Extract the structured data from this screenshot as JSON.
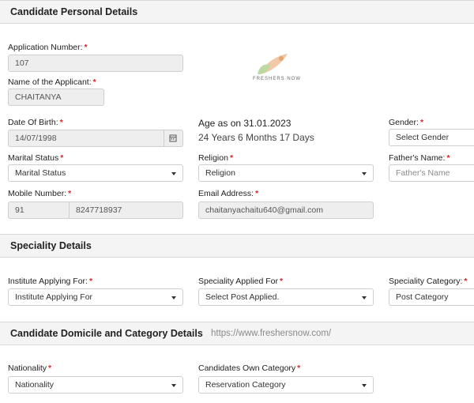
{
  "personal": {
    "title": "Candidate Personal Details",
    "application_number": {
      "label": "Application Number:",
      "value": "107"
    },
    "applicant_name": {
      "label": "Name of the Applicant:",
      "value": "CHAITANYA"
    },
    "dob": {
      "label": "Date Of Birth:",
      "value": "14/07/1998"
    },
    "age": {
      "title": "Age as on 31.01.2023",
      "value": "24 Years 6 Months 17 Days"
    },
    "gender": {
      "label": "Gender:",
      "selected": "Select Gender"
    },
    "marital": {
      "label": "Marital Status",
      "selected": "Marital Status"
    },
    "religion": {
      "label": "Religion",
      "selected": "Religion"
    },
    "father": {
      "label": "Father's Name:",
      "placeholder": "Father's Name"
    },
    "mobile": {
      "label": "Mobile Number:",
      "code": "91",
      "number": "8247718937"
    },
    "email": {
      "label": "Email Address:",
      "value": "chaitanyachaitu640@gmail.com"
    },
    "logo_text": "FRESHERS NOW",
    "required_mark": "*"
  },
  "speciality": {
    "title": "Speciality Details",
    "institute": {
      "label": "Institute Applying For:",
      "selected": "Institute Applying For"
    },
    "applied_for": {
      "label": "Speciality Applied For",
      "selected": "Select Post Applied."
    },
    "category": {
      "label": "Speciality Category:",
      "selected": "Post Category"
    }
  },
  "domicile": {
    "title": "Candidate Domicile and Category Details",
    "watermark": "https://www.freshersnow.com/",
    "nationality": {
      "label": "Nationality",
      "selected": "Nationality"
    },
    "own_category": {
      "label": "Candidates Own Category",
      "selected": "Reservation Category"
    }
  },
  "colors": {
    "required": "#d9262c",
    "readonly_bg": "#eeeeee",
    "header_bg": "#f4f4f4"
  }
}
